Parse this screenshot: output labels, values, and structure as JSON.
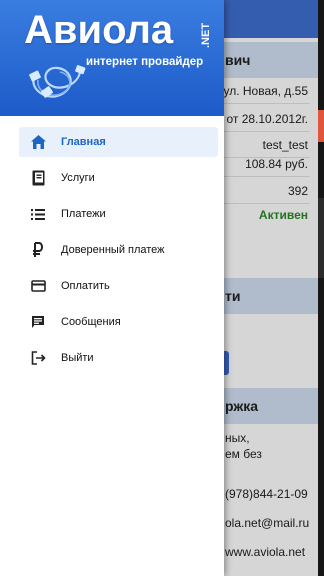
{
  "drawer": {
    "logo": {
      "title": "Авиола",
      "net": ".NET",
      "subtitle": "интернет провайдер"
    },
    "menu": [
      {
        "label": "Главная",
        "icon": "home-icon",
        "active": true
      },
      {
        "label": "Услуги",
        "icon": "book-icon",
        "active": false
      },
      {
        "label": "Платежи",
        "icon": "list-icon",
        "active": false
      },
      {
        "label": "Доверенный платеж",
        "icon": "ruble-icon",
        "active": false
      },
      {
        "label": "Оплатить",
        "icon": "credit-card-icon",
        "active": false
      },
      {
        "label": "Сообщения",
        "icon": "message-icon",
        "active": false
      },
      {
        "label": "Выйти",
        "icon": "logout-icon",
        "active": false
      }
    ]
  },
  "background": {
    "profile": {
      "name_fragment": "вич",
      "address_fragment": "ул. Новая, д.55",
      "date_fragment": "от 28.10.2012г.",
      "login": "test_test",
      "balance": "108.84 руб.",
      "account": "392",
      "status": "Активен"
    },
    "section_fragment": "ти",
    "support": {
      "title_fragment": "ржка",
      "text_line1": "ных,",
      "text_line2": "ем без",
      "phone_fragment": "(978)844-21-09",
      "email_fragment": "ola.net@mail.ru",
      "site_fragment": "www.aviola.net"
    }
  },
  "colors": {
    "header_blue": "#1d5bc9",
    "active_item_bg": "#e8f1fb",
    "active_item_text": "#1d66c4",
    "status_green": "#2a8a2a",
    "card_header_bg": "#d2e1f2"
  }
}
